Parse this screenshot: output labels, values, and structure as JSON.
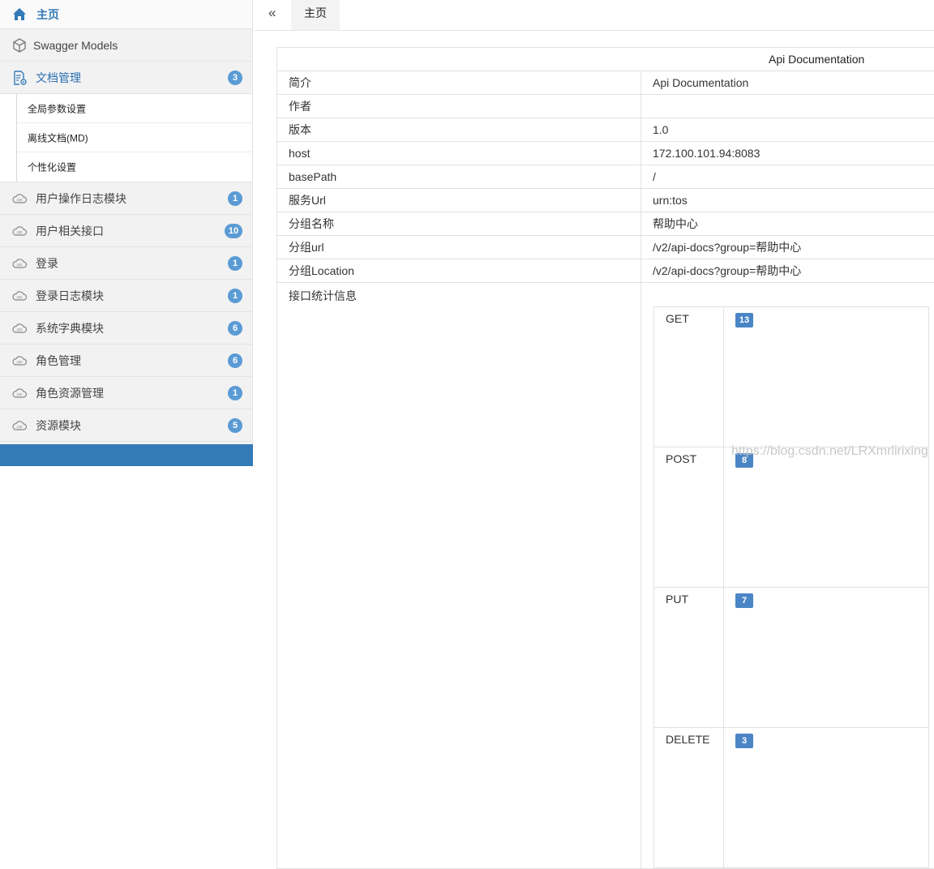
{
  "sidebar": {
    "home_label": "主页",
    "models_label": "Swagger Models",
    "docs_label": "文档管理",
    "docs_badge": "3",
    "sub_items": [
      "全局参数设置",
      "离线文档(MD)",
      "个性化设置"
    ],
    "groups": [
      {
        "label": "用户操作日志模块",
        "badge": "1"
      },
      {
        "label": "用户相关接口",
        "badge": "10"
      },
      {
        "label": "登录",
        "badge": "1"
      },
      {
        "label": "登录日志模块",
        "badge": "1"
      },
      {
        "label": "系统字典模块",
        "badge": "6"
      },
      {
        "label": "角色管理",
        "badge": "6"
      },
      {
        "label": "角色资源管理",
        "badge": "1"
      },
      {
        "label": "资源模块",
        "badge": "5"
      }
    ]
  },
  "topbar": {
    "collapse_symbol": "«",
    "tab_label": "主页"
  },
  "doc": {
    "title": "Api Documentation",
    "rows": [
      {
        "key": "简介",
        "value": "Api Documentation"
      },
      {
        "key": "作者",
        "value": ""
      },
      {
        "key": "版本",
        "value": "1.0"
      },
      {
        "key": "host",
        "value": "172.100.101.94:8083"
      },
      {
        "key": "basePath",
        "value": "/"
      },
      {
        "key": "服务Url",
        "value": "urn:tos"
      },
      {
        "key": "分组名称",
        "value": "帮助中心"
      },
      {
        "key": "分组url",
        "value": "/v2/api-docs?group=帮助中心"
      },
      {
        "key": "分组Location",
        "value": "/v2/api-docs?group=帮助中心"
      }
    ],
    "stats_label": "接口统计信息",
    "stats": [
      {
        "method": "GET",
        "count": "13"
      },
      {
        "method": "POST",
        "count": "8"
      },
      {
        "method": "PUT",
        "count": "7"
      },
      {
        "method": "DELETE",
        "count": "3"
      }
    ]
  },
  "watermark": "https://blog.csdn.net/LRXmrlirixing",
  "colors": {
    "accent": "#337ab7",
    "badge": "#5b9bd5"
  }
}
